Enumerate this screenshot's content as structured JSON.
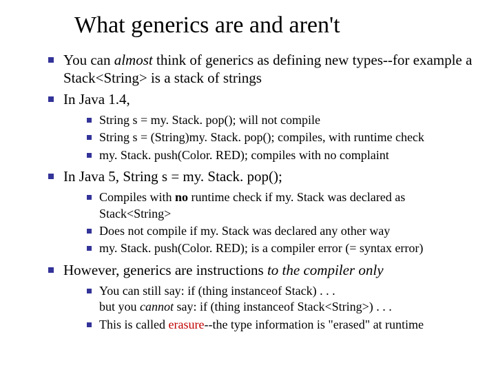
{
  "title": "What generics are and aren't",
  "p1": {
    "a": "You can ",
    "almost": "almost",
    "b": " think of generics as defining new types--for example a ",
    "code": "Stack<String>",
    "c": " is a stack of strings"
  },
  "p2": "In Java 1.4,",
  "p2s": {
    "a1": "String s = my. Stack. pop(); ",
    "a2": "will not compile",
    "b1": "String s = (String)my. Stack. pop();",
    "b2": " compiles, with runtime check",
    "c1": "my. Stack. push(Color. RED);",
    "c2": " compiles with no complaint"
  },
  "p3": {
    "a": "In Java 5, ",
    "code": "String s = my. Stack. pop();"
  },
  "p3s": {
    "a1": "Compiles with ",
    "a_no": "no",
    "a2": " runtime check if ",
    "a_code1": "my. Stack",
    "a3": " was declared as ",
    "a_code2": "Stack<String>",
    "b1": "Does not compile if ",
    "b_code": "my. Stack",
    "b2": " was declared any other way",
    "c_code": "my. Stack. push(Color. RED);",
    "c2": " is a compiler error (= syntax error)"
  },
  "p4": {
    "a": "However, generics are instructions ",
    "ital": "to the compiler only"
  },
  "p4s": {
    "a1": "You can still say:    ",
    "a_code": "if (thing instanceof Stack) . . .",
    "b1": "but you ",
    "b_cannot": "cannot",
    "b2": " say: ",
    "b_code": "if (thing instanceof Stack<String>) . . .",
    "c1": "This is called ",
    "c_erasure": "erasure",
    "c2": "--the type information is \"erased\" at runtime"
  }
}
